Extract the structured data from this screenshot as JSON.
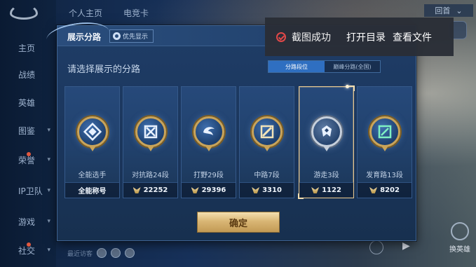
{
  "nav": {
    "items": [
      {
        "label": "主页",
        "chevron": false,
        "dot": false
      },
      {
        "label": "战绩",
        "chevron": false,
        "dot": false
      },
      {
        "label": "英雄",
        "chevron": false,
        "dot": false
      },
      {
        "label": "图鉴",
        "chevron": true,
        "dot": false
      },
      {
        "label": "荣誉",
        "chevron": true,
        "dot": true
      },
      {
        "label": "IP卫队",
        "chevron": true,
        "dot": false
      },
      {
        "label": "游戏",
        "chevron": true,
        "dot": false
      },
      {
        "label": "社交",
        "chevron": true,
        "dot": true
      }
    ]
  },
  "top_tabs": [
    "个人主页",
    "电竞卡"
  ],
  "top_right": {
    "label": "回首",
    "chevron": "⌄"
  },
  "recent_label": "最近访客",
  "swap_hero_label": "换英雄",
  "modal": {
    "title": "展示分路",
    "priority_label": "优先显示",
    "prompt": "请选择展示的分路",
    "tabs": [
      {
        "label": "分路段位",
        "active": true
      },
      {
        "label": "巅峰分路(全国)",
        "active": false
      }
    ],
    "cards": [
      {
        "route": "全能选手",
        "score": "全能称号",
        "icon": "all-round-badge-icon",
        "metal": "gold",
        "selected": false,
        "score_icon": false
      },
      {
        "route": "对抗路24段",
        "score": "22252",
        "icon": "clash-lane-badge-icon",
        "metal": "gold",
        "selected": false,
        "score_icon": true
      },
      {
        "route": "打野29段",
        "score": "29396",
        "icon": "jungle-badge-icon",
        "metal": "gold",
        "selected": false,
        "score_icon": true
      },
      {
        "route": "中路7段",
        "score": "3310",
        "icon": "mid-lane-badge-icon",
        "metal": "gold",
        "selected": false,
        "score_icon": true
      },
      {
        "route": "游走3段",
        "score": "1122",
        "icon": "roam-badge-icon",
        "metal": "silver",
        "selected": true,
        "score_icon": true
      },
      {
        "route": "发育路13段",
        "score": "8202",
        "icon": "farm-lane-badge-icon",
        "metal": "gold",
        "selected": false,
        "score_icon": true
      }
    ],
    "confirm_label": "确定"
  },
  "toast": {
    "message": "截图成功",
    "action_open_dir": "打开目录",
    "action_view_file": "查看文件"
  },
  "colors": {
    "modal_bg": "#1f3d67",
    "accent_gold": "#c9a45a",
    "tab_active": "#2f6fc1",
    "toast_check": "#e04848"
  }
}
